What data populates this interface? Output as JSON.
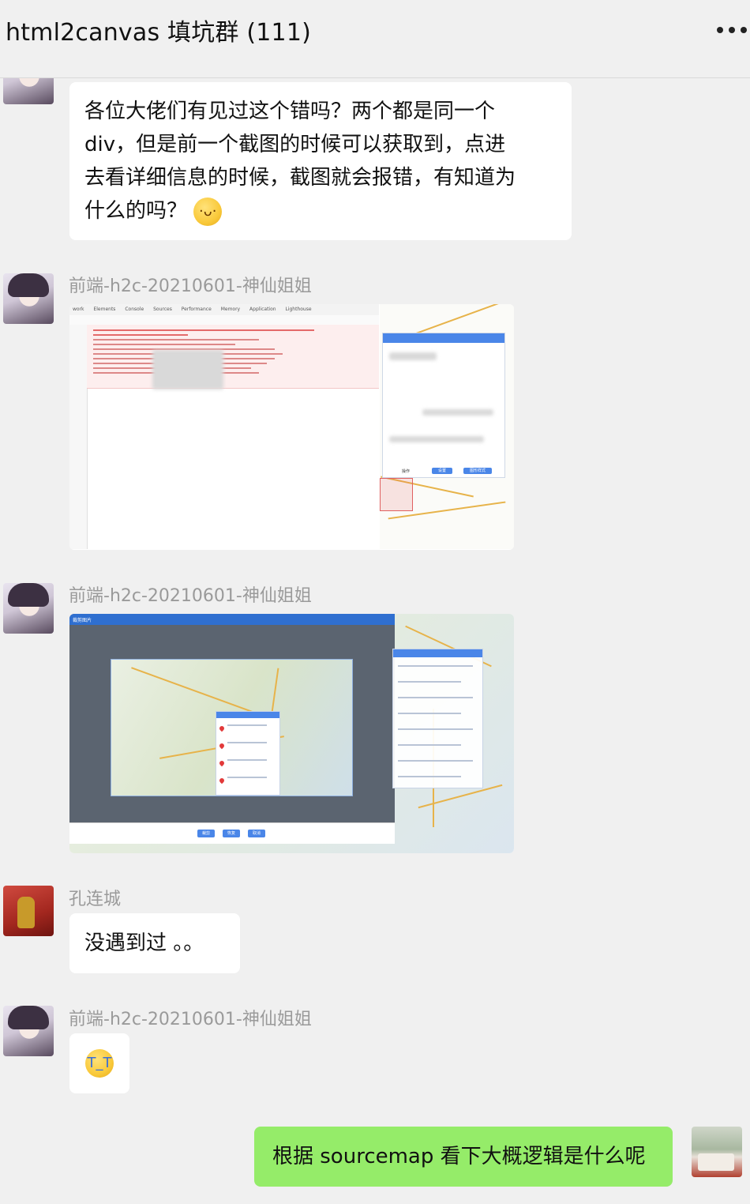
{
  "header": {
    "title": "html2canvas 填坑群 (111)",
    "more_icon": "more-dots-icon"
  },
  "messages": [
    {
      "type": "text",
      "sender": "",
      "avatar": "anime-girl-avatar",
      "lines": [
        "各位大佬们有见过这个错吗？两个都是同一个",
        "div，但是前一个截图的时候可以获取到，点进",
        "去看详细信息的时候，截图就会报错，有知道为",
        "什么的吗？"
      ],
      "emoji": "pleading-face-emoji"
    },
    {
      "type": "image",
      "sender": "前端-h2c-20210601-神仙姐姐",
      "avatar": "anime-girl-avatar",
      "image": {
        "kind": "devtools-console-screenshot",
        "tabs": [
          "work",
          "Elements",
          "Console",
          "Sources",
          "Performance",
          "Memory",
          "Application",
          "Lighthouse"
        ],
        "panel_buttons": [
          "设置",
          "图形样式"
        ],
        "panel_label": "操作"
      }
    },
    {
      "type": "image",
      "sender": "前端-h2c-20210601-神仙姐姐",
      "avatar": "anime-girl-avatar",
      "image": {
        "kind": "map-screenshot",
        "window_title": "裁剪图片",
        "buttons": [
          "裁剪",
          "恢复",
          "取消"
        ]
      }
    },
    {
      "type": "text",
      "sender": "孔连城",
      "avatar": "red-wedding-avatar",
      "lines": [
        "没遇到过 。。"
      ]
    },
    {
      "type": "emoji",
      "sender": "前端-h2c-20210601-神仙姐姐",
      "avatar": "anime-girl-avatar",
      "emoji": "crying-face-emoji"
    },
    {
      "type": "text",
      "self": true,
      "avatar": "self-photo-avatar",
      "lines": [
        "根据 sourcemap 看下大概逻辑是什么呢"
      ]
    }
  ],
  "colors": {
    "background": "#f0f0f0",
    "bubble_incoming": "#ffffff",
    "bubble_outgoing": "#95ec69",
    "sender_name": "#9a9a9a"
  }
}
